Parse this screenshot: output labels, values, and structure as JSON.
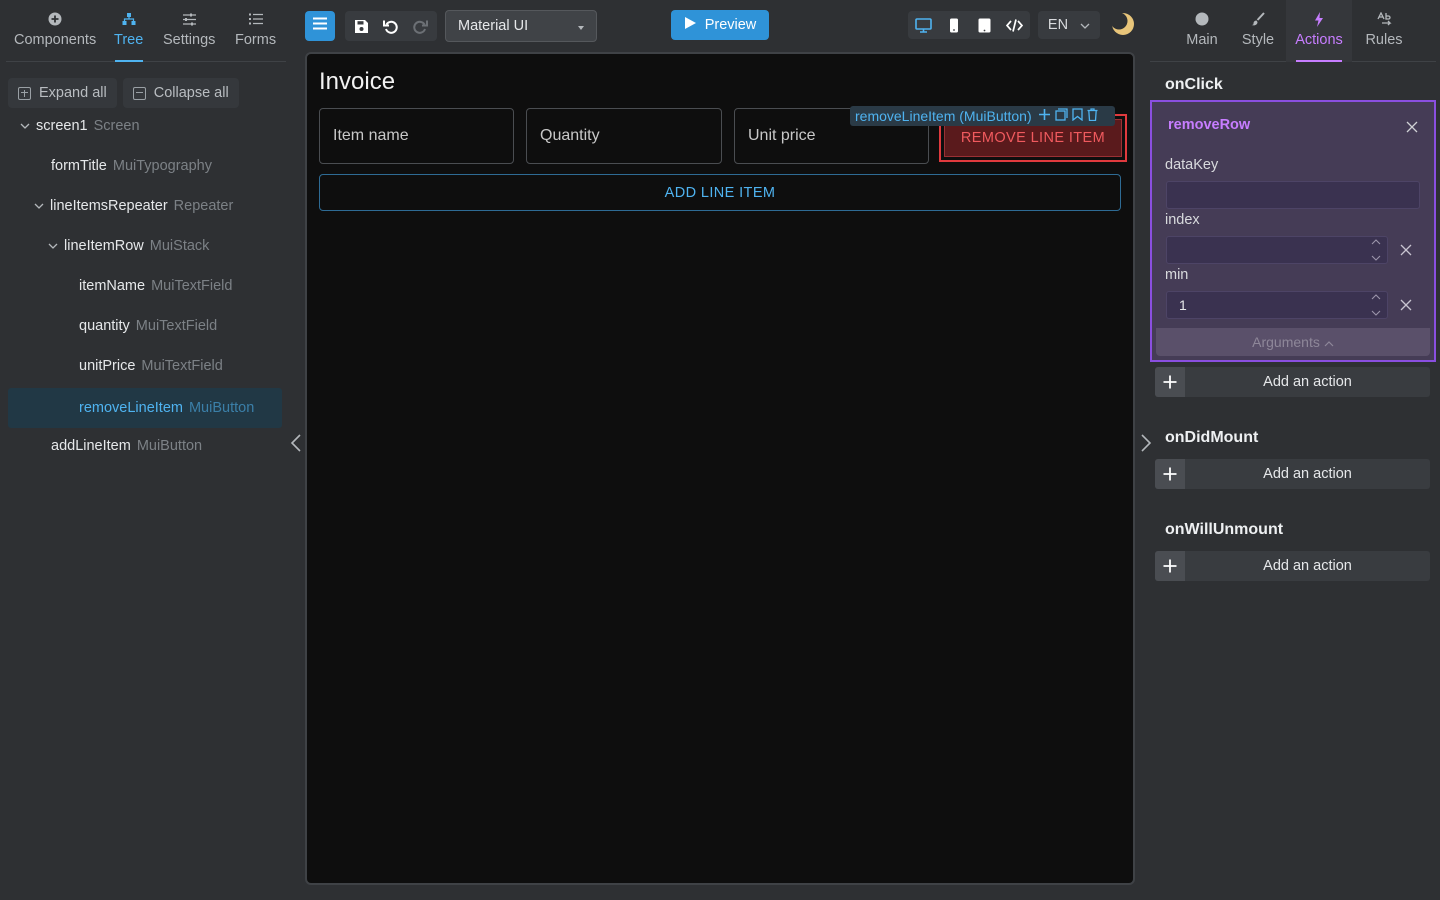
{
  "left_panel": {
    "tabs": [
      {
        "label": "Components",
        "icon": "plus-circle-icon"
      },
      {
        "label": "Tree",
        "icon": "hierarchy-icon",
        "active": true
      },
      {
        "label": "Settings",
        "icon": "sliders-icon"
      },
      {
        "label": "Forms",
        "icon": "list-icon"
      }
    ],
    "expand_all": "Expand all",
    "collapse_all": "Collapse all",
    "tree": [
      {
        "name": "screen1",
        "type": "Screen"
      },
      {
        "name": "formTitle",
        "type": "MuiTypography"
      },
      {
        "name": "lineItemsRepeater",
        "type": "Repeater"
      },
      {
        "name": "lineItemRow",
        "type": "MuiStack"
      },
      {
        "name": "itemName",
        "type": "MuiTextField"
      },
      {
        "name": "quantity",
        "type": "MuiTextField"
      },
      {
        "name": "unitPrice",
        "type": "MuiTextField"
      },
      {
        "name": "removeLineItem",
        "type": "MuiButton",
        "selected": true
      },
      {
        "name": "addLineItem",
        "type": "MuiButton"
      }
    ]
  },
  "toolbar": {
    "library": "Material UI",
    "preview": "Preview",
    "language": "EN"
  },
  "canvas": {
    "title": "Invoice",
    "fields": [
      "Item name",
      "Quantity",
      "Unit price"
    ],
    "selection_label": "removeLineItem (MuiButton)",
    "remove_button": "REMOVE LINE ITEM",
    "add_button": "ADD LINE ITEM"
  },
  "right_panel": {
    "tabs": [
      {
        "label": "Main",
        "icon": "circle-icon"
      },
      {
        "label": "Style",
        "icon": "brush-icon"
      },
      {
        "label": "Actions",
        "icon": "lightning-icon",
        "active": true
      },
      {
        "label": "Rules",
        "icon": "rules-icon"
      }
    ],
    "events": {
      "onClick": "onClick",
      "onDidMount": "onDidMount",
      "onWillUnmount": "onWillUnmount"
    },
    "action": {
      "name": "removeRow",
      "args": [
        {
          "label": "dataKey",
          "value": ""
        },
        {
          "label": "index",
          "value": ""
        },
        {
          "label": "min",
          "value": "1"
        }
      ],
      "arguments_toggle": "Arguments"
    },
    "add_action": "Add an action"
  },
  "colors": {
    "accent_blue": "#2f93d8",
    "accent_purple": "#c77dff",
    "danger": "#e03a3e"
  }
}
